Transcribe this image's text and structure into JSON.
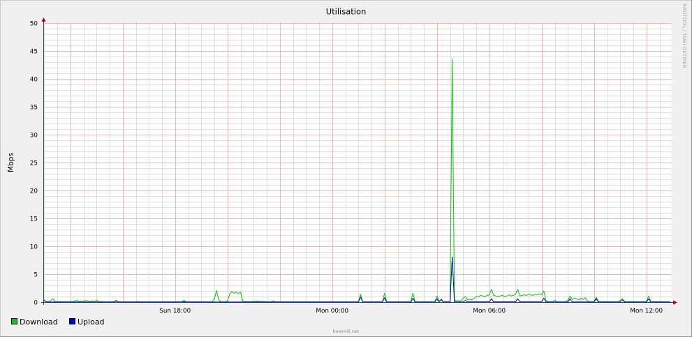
{
  "chart_data": {
    "type": "line",
    "title": "Utilisation",
    "ylabel": "Mbps",
    "ylim": [
      0,
      50
    ],
    "y_ticks": [
      "0",
      "5",
      "10",
      "15",
      "20",
      "25",
      "30",
      "35",
      "40",
      "45",
      "50"
    ],
    "xlim": [
      "Sun 12:58",
      "Mon 12:58"
    ],
    "x_ticks": [
      "Sun 18:00",
      "Mon 00:00",
      "Mon 06:00",
      "Mon 12:00"
    ],
    "grid": "on",
    "legend": "bottom-left",
    "series": [
      {
        "name": "Download",
        "color": "#00CC00",
        "points": [
          [
            "Sun 13:00",
            0.2
          ],
          [
            "Sun 13:05",
            0.1
          ],
          [
            "Sun 13:10",
            0.1
          ],
          [
            "Sun 13:15",
            0.2
          ],
          [
            "Sun 13:20",
            0.6
          ],
          [
            "Sun 13:25",
            0.1
          ],
          [
            "Sun 13:55",
            0.05
          ],
          [
            "Sun 14:00",
            0.1
          ],
          [
            "Sun 14:05",
            0.05
          ],
          [
            "Sun 14:10",
            0.2
          ],
          [
            "Sun 14:15",
            0.3
          ],
          [
            "Sun 14:20",
            0.1
          ],
          [
            "Sun 14:25",
            0.2
          ],
          [
            "Sun 14:30",
            0.1
          ],
          [
            "Sun 14:35",
            0.3
          ],
          [
            "Sun 14:40",
            0.2
          ],
          [
            "Sun 14:45",
            0.1
          ],
          [
            "Sun 14:50",
            0.2
          ],
          [
            "Sun 14:55",
            0.1
          ],
          [
            "Sun 15:00",
            0.3
          ],
          [
            "Sun 15:05",
            0.1
          ],
          [
            "Sun 15:10",
            0.1
          ],
          [
            "Sun 15:20",
            0.05
          ],
          [
            "Sun 16:30",
            0.05
          ],
          [
            "Sun 16:35",
            0.1
          ],
          [
            "Sun 16:40",
            0.05
          ],
          [
            "Sun 18:15",
            0.05
          ],
          [
            "Sun 18:20",
            0.3
          ],
          [
            "Sun 18:25",
            0.05
          ],
          [
            "Sun 19:25",
            0.05
          ],
          [
            "Sun 19:30",
            0.6
          ],
          [
            "Sun 19:35",
            2.1
          ],
          [
            "Sun 19:40",
            0.4
          ],
          [
            "Sun 19:45",
            0.05
          ],
          [
            "Sun 19:55",
            0.05
          ],
          [
            "Sun 20:00",
            0.2
          ],
          [
            "Sun 20:05",
            1.4
          ],
          [
            "Sun 20:10",
            1.9
          ],
          [
            "Sun 20:15",
            1.6
          ],
          [
            "Sun 20:20",
            1.8
          ],
          [
            "Sun 20:25",
            1.5
          ],
          [
            "Sun 20:30",
            1.8
          ],
          [
            "Sun 20:35",
            0.2
          ],
          [
            "Sun 20:40",
            0.1
          ],
          [
            "Sun 21:00",
            0.1
          ],
          [
            "Sun 21:05",
            0.15
          ],
          [
            "Sun 21:40",
            0.05
          ],
          [
            "Sun 21:45",
            0.2
          ],
          [
            "Sun 21:50",
            0.05
          ],
          [
            "Mon 01:00",
            0.05
          ],
          [
            "Mon 01:05",
            1.4
          ],
          [
            "Mon 01:10",
            0.05
          ],
          [
            "Mon 01:55",
            0.05
          ],
          [
            "Mon 02:00",
            1.6
          ],
          [
            "Mon 02:05",
            0.05
          ],
          [
            "Mon 03:00",
            0.05
          ],
          [
            "Mon 03:05",
            1.6
          ],
          [
            "Mon 03:10",
            0.05
          ],
          [
            "Mon 03:55",
            0.05
          ],
          [
            "Mon 04:00",
            1.1
          ],
          [
            "Mon 04:05",
            0.2
          ],
          [
            "Mon 04:10",
            0.3
          ],
          [
            "Mon 04:15",
            0.05
          ],
          [
            "Mon 04:30",
            0.1
          ],
          [
            "Mon 04:35",
            43.6
          ],
          [
            "Mon 04:40",
            0.3
          ],
          [
            "Mon 04:55",
            0.2
          ],
          [
            "Mon 05:00",
            0.7
          ],
          [
            "Mon 05:05",
            1.0
          ],
          [
            "Mon 05:10",
            0.4
          ],
          [
            "Mon 05:15",
            0.5
          ],
          [
            "Mon 05:20",
            0.4
          ],
          [
            "Mon 05:25",
            0.7
          ],
          [
            "Mon 05:30",
            1.0
          ],
          [
            "Mon 05:35",
            0.9
          ],
          [
            "Mon 05:40",
            1.2
          ],
          [
            "Mon 05:45",
            1.1
          ],
          [
            "Mon 05:50",
            1.0
          ],
          [
            "Mon 05:55",
            1.2
          ],
          [
            "Mon 06:00",
            1.3
          ],
          [
            "Mon 06:05",
            2.3
          ],
          [
            "Mon 06:10",
            1.2
          ],
          [
            "Mon 06:15",
            1.1
          ],
          [
            "Mon 06:20",
            1.0
          ],
          [
            "Mon 06:25",
            1.1
          ],
          [
            "Mon 06:30",
            1.2
          ],
          [
            "Mon 06:35",
            1.0
          ],
          [
            "Mon 06:40",
            1.1
          ],
          [
            "Mon 06:45",
            1.3
          ],
          [
            "Mon 06:50",
            1.1
          ],
          [
            "Mon 06:55",
            1.2
          ],
          [
            "Mon 07:00",
            1.4
          ],
          [
            "Mon 07:05",
            2.3
          ],
          [
            "Mon 07:10",
            1.1
          ],
          [
            "Mon 07:15",
            1.2
          ],
          [
            "Mon 07:20",
            1.3
          ],
          [
            "Mon 07:25",
            1.2
          ],
          [
            "Mon 07:30",
            1.4
          ],
          [
            "Mon 07:35",
            1.3
          ],
          [
            "Mon 07:40",
            1.2
          ],
          [
            "Mon 07:45",
            1.4
          ],
          [
            "Mon 07:50",
            1.3
          ],
          [
            "Mon 07:55",
            1.5
          ],
          [
            "Mon 08:00",
            1.3
          ],
          [
            "Mon 08:05",
            2.0
          ],
          [
            "Mon 08:10",
            0.2
          ],
          [
            "Mon 08:15",
            0.1
          ],
          [
            "Mon 08:25",
            0.05
          ],
          [
            "Mon 08:30",
            0.3
          ],
          [
            "Mon 08:35",
            0.05
          ],
          [
            "Mon 08:55",
            0.05
          ],
          [
            "Mon 09:00",
            0.3
          ],
          [
            "Mon 09:05",
            1.1
          ],
          [
            "Mon 09:10",
            0.5
          ],
          [
            "Mon 09:15",
            0.7
          ],
          [
            "Mon 09:20",
            0.6
          ],
          [
            "Mon 09:25",
            0.4
          ],
          [
            "Mon 09:30",
            0.7
          ],
          [
            "Mon 09:35",
            0.5
          ],
          [
            "Mon 09:40",
            0.8
          ],
          [
            "Mon 09:45",
            0.2
          ],
          [
            "Mon 09:50",
            0.05
          ],
          [
            "Mon 10:00",
            0.1
          ],
          [
            "Mon 10:05",
            0.9
          ],
          [
            "Mon 10:10",
            0.1
          ],
          [
            "Mon 10:55",
            0.05
          ],
          [
            "Mon 11:00",
            0.3
          ],
          [
            "Mon 11:05",
            0.6
          ],
          [
            "Mon 11:10",
            0.1
          ],
          [
            "Mon 11:55",
            0.05
          ],
          [
            "Mon 12:00",
            0.1
          ],
          [
            "Mon 12:05",
            1.1
          ],
          [
            "Mon 12:10",
            0.1
          ],
          [
            "Mon 12:55",
            0.05
          ]
        ]
      },
      {
        "name": "Upload",
        "color": "#0000CC",
        "points": [
          [
            "Sun 13:00",
            0.4
          ],
          [
            "Sun 13:05",
            0.02
          ],
          [
            "Sun 15:40",
            0.02
          ],
          [
            "Sun 15:45",
            0.3
          ],
          [
            "Sun 15:50",
            0.02
          ],
          [
            "Sun 18:15",
            0.02
          ],
          [
            "Sun 18:20",
            0.1
          ],
          [
            "Sun 18:25",
            0.02
          ],
          [
            "Mon 01:00",
            0.02
          ],
          [
            "Mon 01:05",
            0.9
          ],
          [
            "Mon 01:10",
            0.02
          ],
          [
            "Mon 01:55",
            0.02
          ],
          [
            "Mon 02:00",
            0.8
          ],
          [
            "Mon 02:05",
            0.02
          ],
          [
            "Mon 03:00",
            0.02
          ],
          [
            "Mon 03:05",
            0.7
          ],
          [
            "Mon 03:10",
            0.02
          ],
          [
            "Mon 03:55",
            0.02
          ],
          [
            "Mon 04:00",
            0.6
          ],
          [
            "Mon 04:05",
            0.05
          ],
          [
            "Mon 04:10",
            0.5
          ],
          [
            "Mon 04:15",
            0.02
          ],
          [
            "Mon 04:30",
            0.02
          ],
          [
            "Mon 04:35",
            8.1
          ],
          [
            "Mon 04:40",
            0.05
          ],
          [
            "Mon 05:00",
            0.02
          ],
          [
            "Mon 05:05",
            0.3
          ],
          [
            "Mon 05:10",
            0.05
          ],
          [
            "Mon 06:00",
            0.05
          ],
          [
            "Mon 06:05",
            0.6
          ],
          [
            "Mon 06:10",
            0.05
          ],
          [
            "Mon 07:00",
            0.05
          ],
          [
            "Mon 07:05",
            0.6
          ],
          [
            "Mon 07:10",
            0.05
          ],
          [
            "Mon 08:00",
            0.05
          ],
          [
            "Mon 08:05",
            0.7
          ],
          [
            "Mon 08:10",
            0.02
          ],
          [
            "Mon 09:00",
            0.02
          ],
          [
            "Mon 09:05",
            0.6
          ],
          [
            "Mon 09:10",
            0.05
          ],
          [
            "Mon 10:00",
            0.02
          ],
          [
            "Mon 10:05",
            0.6
          ],
          [
            "Mon 10:10",
            0.02
          ],
          [
            "Mon 11:00",
            0.02
          ],
          [
            "Mon 11:05",
            0.4
          ],
          [
            "Mon 11:10",
            0.02
          ],
          [
            "Mon 12:00",
            0.02
          ],
          [
            "Mon 12:05",
            0.6
          ],
          [
            "Mon 12:10",
            0.02
          ],
          [
            "Mon 12:55",
            0.02
          ]
        ]
      }
    ]
  },
  "footer": "bowmill.net",
  "signature": "RRDTOOL / TOBI OETIKER"
}
